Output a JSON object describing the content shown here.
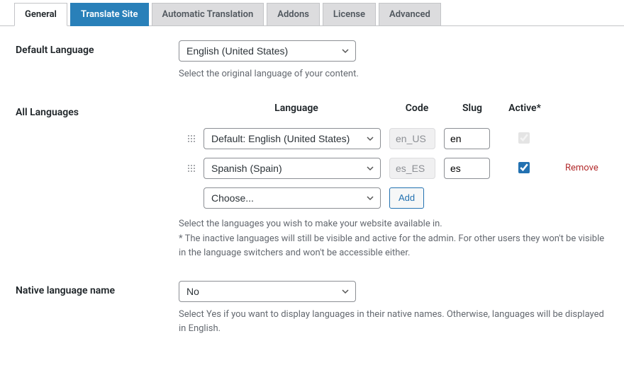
{
  "tabs": {
    "general": "General",
    "translate_site": "Translate Site",
    "automatic_translation": "Automatic Translation",
    "addons": "Addons",
    "license": "License",
    "advanced": "Advanced"
  },
  "default_language": {
    "label": "Default Language",
    "value": "English (United States)",
    "help": "Select the original language of your content."
  },
  "all_languages": {
    "label": "All Languages",
    "headers": {
      "language": "Language",
      "code": "Code",
      "slug": "Slug",
      "active": "Active*"
    },
    "rows": [
      {
        "language": "Default: English (United States)",
        "code": "en_US",
        "slug": "en",
        "active": true,
        "disabled_active": true,
        "removable": false
      },
      {
        "language": "Spanish (Spain)",
        "code": "es_ES",
        "slug": "es",
        "active": true,
        "disabled_active": false,
        "removable": true
      }
    ],
    "choose_placeholder": "Choose...",
    "add_label": "Add",
    "remove_label": "Remove",
    "help1": "Select the languages you wish to make your website available in.",
    "help2": "* The inactive languages will still be visible and active for the admin. For other users they won't be visible in the language switchers and won't be accessible either."
  },
  "native_name": {
    "label": "Native language name",
    "value": "No",
    "help": "Select Yes if you want to display languages in their native names. Otherwise, languages will be displayed in English."
  }
}
